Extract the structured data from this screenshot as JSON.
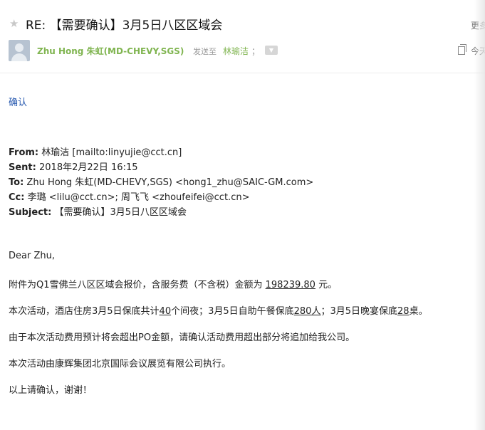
{
  "header": {
    "subject": "RE: 【需要确认】3月5日八区区域会",
    "more_label": "更多",
    "sender_name": "Zhu Hong 朱虹(MD-CHEVY,SGS)",
    "sent_to_label": "发送至",
    "recipient": "林瑜洁",
    "separator": "；",
    "date_label": "今天"
  },
  "body": {
    "confirm": "确认",
    "quoted": {
      "from_label": "From:",
      "from_value": "林瑜洁 [mailto:linyujie@cct.cn]",
      "sent_label": "Sent:",
      "sent_value": "2018年2月22日 16:15",
      "to_label": "To:",
      "to_value": "Zhu Hong 朱虹(MD-CHEVY,SGS) <hong1_zhu@SAIC-GM.com>",
      "cc_label": "Cc:",
      "cc_value": "李璐 <lilu@cct.cn>; 周飞飞 <zhoufeifei@cct.cn>",
      "subject_label": "Subject:",
      "subject_value": "【需要确认】3月5日八区区域会"
    },
    "greeting": "Dear Zhu,",
    "p1_a": "附件为Q1雪佛兰八区区域会报价，含服务费（不含税）金额为 ",
    "p1_amount": "198239.80",
    "p1_b": " 元。",
    "p2_a": "本次活动，酒店住房3月5日保底共计",
    "p2_n1": "40",
    "p2_b": "个间夜；3月5日自助午餐保底",
    "p2_n2": "280人",
    "p2_c": "；3月5日晚宴保底",
    "p2_n3": "28",
    "p2_d": "桌。",
    "p3": "由于本次活动费用预计将会超出PO金额，请确认活动费用超出部分将追加给我公司。",
    "p4": "本次活动由康辉集团北京国际会议展览有限公司执行。",
    "p5": "以上请确认，谢谢！"
  },
  "colors": {
    "sender": "#7fb44f",
    "link_blue": "#2a5bb0",
    "text": "#222222"
  }
}
